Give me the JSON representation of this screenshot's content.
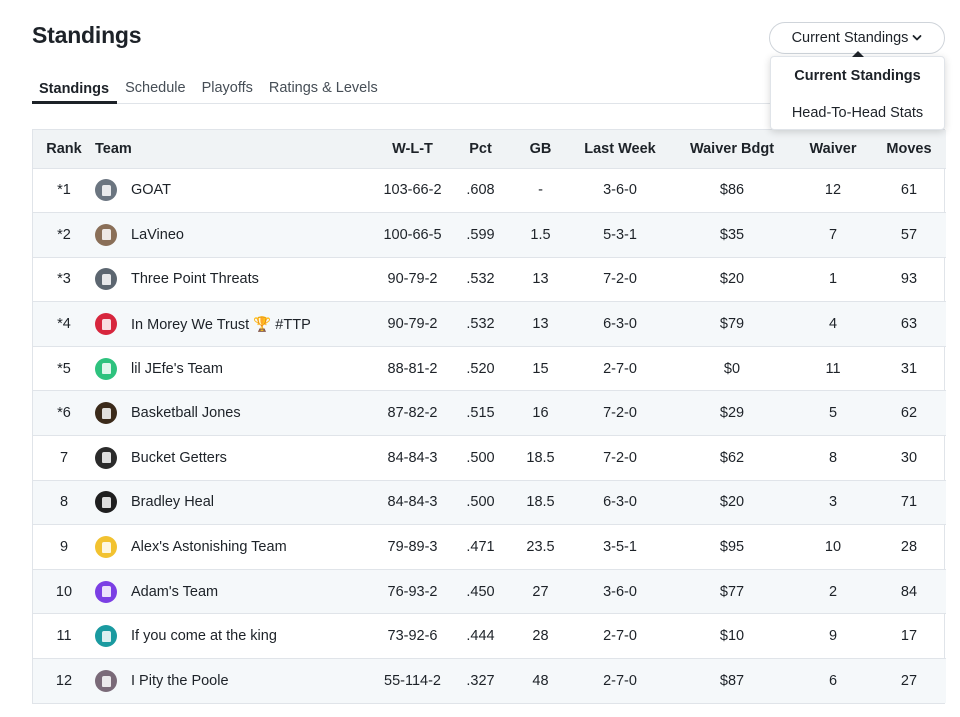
{
  "header": {
    "title": "Standings"
  },
  "tabs": [
    {
      "label": "Standings",
      "active": true
    },
    {
      "label": "Schedule",
      "active": false
    },
    {
      "label": "Playoffs",
      "active": false
    },
    {
      "label": "Ratings & Levels",
      "active": false
    }
  ],
  "view_dropdown": {
    "selected": "Current Standings",
    "options": [
      "Current Standings",
      "Head-To-Head Stats"
    ]
  },
  "table": {
    "columns": [
      "Rank",
      "Team",
      "W-L-T",
      "Pct",
      "GB",
      "Last Week",
      "Waiver Bdgt",
      "Waiver",
      "Moves"
    ],
    "rows": [
      {
        "rank": "*1",
        "team": "GOAT",
        "wlt": "103-66-2",
        "pct": ".608",
        "gb": "-",
        "last_week": "3-6-0",
        "budget": "$86",
        "waiver": "12",
        "moves": "61",
        "logo_color": "#6b7580",
        "logo_icon": "jersey-icon"
      },
      {
        "rank": "*2",
        "team": "LaVineo",
        "wlt": "100-66-5",
        "pct": ".599",
        "gb": "1.5",
        "last_week": "5-3-1",
        "budget": "$35",
        "waiver": "7",
        "moves": "57",
        "logo_color": "#8a6f58",
        "logo_icon": "player-photo-icon"
      },
      {
        "rank": "*3",
        "team": "Three Point Threats",
        "wlt": "90-79-2",
        "pct": ".532",
        "gb": "13",
        "last_week": "7-2-0",
        "budget": "$20",
        "waiver": "1",
        "moves": "93",
        "logo_color": "#5c6670",
        "logo_icon": "jersey-icon"
      },
      {
        "rank": "*4",
        "team": "In Morey We Trust 🏆 #TTP",
        "wlt": "90-79-2",
        "pct": ".532",
        "gb": "13",
        "last_week": "6-3-0",
        "budget": "$79",
        "waiver": "4",
        "moves": "63",
        "logo_color": "#d7263d",
        "logo_icon": "jersey-icon"
      },
      {
        "rank": "*5",
        "team": "lil JEfe's Team",
        "wlt": "88-81-2",
        "pct": ".520",
        "gb": "15",
        "last_week": "2-7-0",
        "budget": "$0",
        "waiver": "11",
        "moves": "31",
        "logo_color": "#2ec27e",
        "logo_icon": "jersey-icon"
      },
      {
        "rank": "*6",
        "team": "Basketball Jones",
        "wlt": "87-82-2",
        "pct": ".515",
        "gb": "16",
        "last_week": "7-2-0",
        "budget": "$29",
        "waiver": "5",
        "moves": "62",
        "logo_color": "#3b2a1a",
        "logo_icon": "flame-icon"
      },
      {
        "rank": "7",
        "team": "Bucket Getters",
        "wlt": "84-84-3",
        "pct": ".500",
        "gb": "18.5",
        "last_week": "7-2-0",
        "budget": "$62",
        "waiver": "8",
        "moves": "30",
        "logo_color": "#2b2b2b",
        "logo_icon": "nets-logo-icon"
      },
      {
        "rank": "8",
        "team": "Bradley Heal",
        "wlt": "84-84-3",
        "pct": ".500",
        "gb": "18.5",
        "last_week": "6-3-0",
        "budget": "$20",
        "waiver": "3",
        "moves": "71",
        "logo_color": "#1f1f1f",
        "logo_icon": "player-photo-icon"
      },
      {
        "rank": "9",
        "team": "Alex's Astonishing Team",
        "wlt": "79-89-3",
        "pct": ".471",
        "gb": "23.5",
        "last_week": "3-5-1",
        "budget": "$95",
        "waiver": "10",
        "moves": "28",
        "logo_color": "#f2c230",
        "logo_icon": "jersey-icon"
      },
      {
        "rank": "10",
        "team": "Adam's Team",
        "wlt": "76-93-2",
        "pct": ".450",
        "gb": "27",
        "last_week": "3-6-0",
        "budget": "$77",
        "waiver": "2",
        "moves": "84",
        "logo_color": "#7b3fe4",
        "logo_icon": "jersey-icon"
      },
      {
        "rank": "11",
        "team": "If you come at the king",
        "wlt": "73-92-6",
        "pct": ".444",
        "gb": "28",
        "last_week": "2-7-0",
        "budget": "$10",
        "waiver": "9",
        "moves": "17",
        "logo_color": "#1a9aa0",
        "logo_icon": "jersey-icon"
      },
      {
        "rank": "12",
        "team": "I Pity the Poole",
        "wlt": "55-114-2",
        "pct": ".327",
        "gb": "48",
        "last_week": "2-7-0",
        "budget": "$87",
        "waiver": "6",
        "moves": "27",
        "logo_color": "#7a6a78",
        "logo_icon": "player-photo-icon"
      }
    ]
  }
}
